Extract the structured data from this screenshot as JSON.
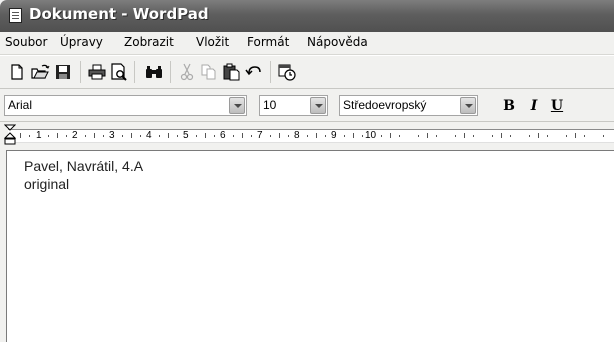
{
  "window": {
    "title": "Dokument - WordPad"
  },
  "menu": {
    "items": [
      "Soubor",
      "Úpravy",
      "Zobrazit",
      "Vložit",
      "Formát",
      "Nápověda"
    ]
  },
  "toolbar": {
    "buttons": [
      "new-document-icon",
      "open-folder-icon",
      "save-icon",
      "print-icon",
      "print-preview-icon",
      "find-icon",
      "cut-icon",
      "copy-icon",
      "paste-icon",
      "undo-icon",
      "date-time-icon"
    ]
  },
  "format": {
    "font": "Arial",
    "size": "10",
    "script": "Středoevropský",
    "bold_label": "B",
    "italic_label": "I",
    "underline_label": "U"
  },
  "ruler": {
    "numbers": [
      "1",
      "2",
      "3",
      "4",
      "5",
      "6",
      "7",
      "8",
      "9",
      "10"
    ]
  },
  "document": {
    "lines": [
      "Pavel, Navrátil, 4.A",
      "original"
    ]
  }
}
